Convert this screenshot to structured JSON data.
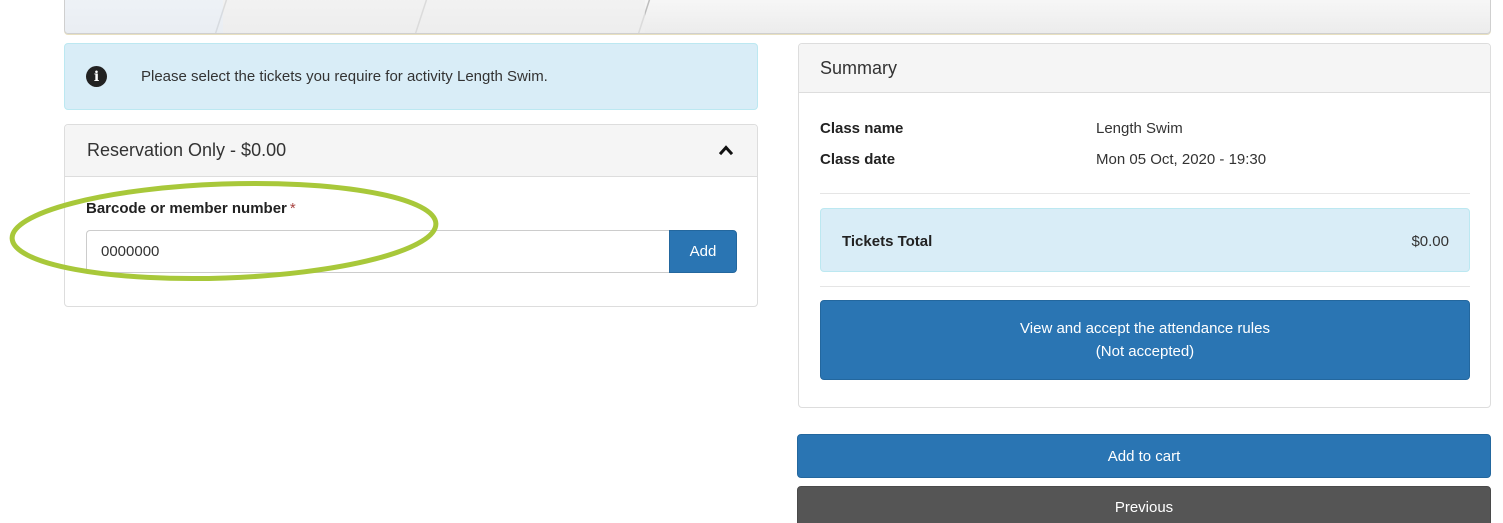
{
  "alert": {
    "icon": "info-circle-icon",
    "message": "Please select the tickets you require for activity Length Swim."
  },
  "ticket_panel": {
    "title": "Reservation Only - $0.00",
    "collapse_icon": "chevron-up-icon",
    "field_label": "Barcode or member number",
    "required_marker": "*",
    "barcode_value": "0000000",
    "add_label": "Add",
    "highlight_color": "#a8c83a"
  },
  "summary": {
    "title": "Summary",
    "class_name_label": "Class name",
    "class_name_value": "Length Swim",
    "class_date_label": "Class date",
    "class_date_value": "Mon 05 Oct, 2020 - 19:30",
    "tickets_total_label": "Tickets Total",
    "tickets_total_value": "$0.00",
    "rules_line1": "View and accept the attendance rules",
    "rules_line2": "(Not accepted)"
  },
  "actions": {
    "add_to_cart": "Add to cart",
    "previous": "Previous"
  },
  "colors": {
    "primary": "#2a75b3",
    "info_bg": "#d9edf7",
    "secondary": "#555555"
  }
}
